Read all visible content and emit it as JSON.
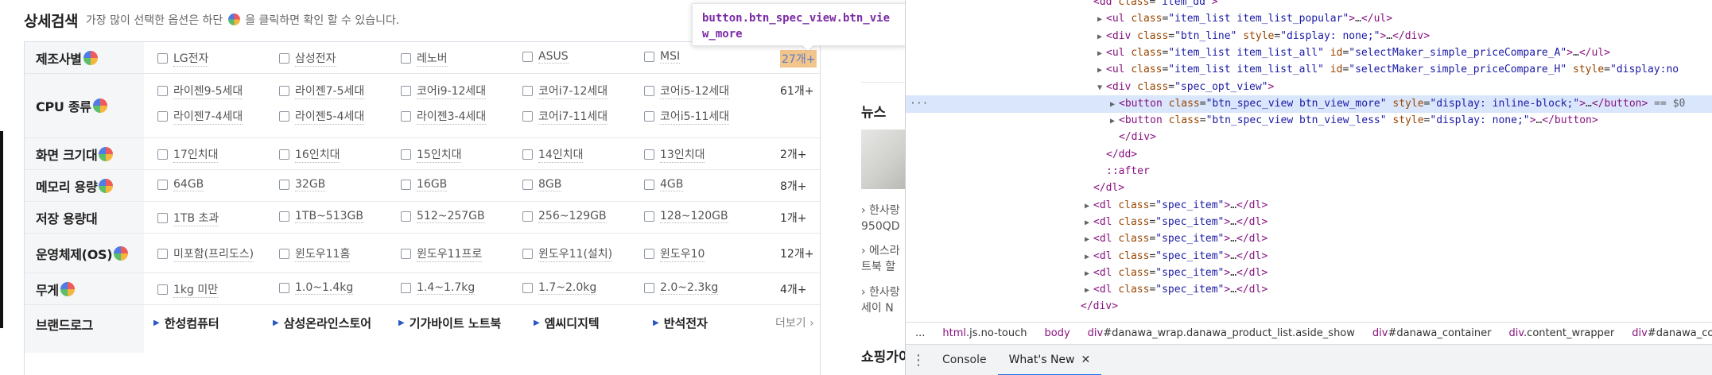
{
  "header": {
    "title": "상세검색",
    "desc_before": "가장 많이 선택한 옵션은 하단",
    "desc_after": "을 클릭하면 확인 할 수 있습니다."
  },
  "tooltip": {
    "text": "button.btn_spec_view.btn_view_more"
  },
  "filters": [
    {
      "label": "제조사별",
      "has_ball": true,
      "options": [
        "LG전자",
        "삼성전자",
        "레노버",
        "ASUS",
        "MSI"
      ],
      "more": "27개+",
      "more_highlighted": true
    },
    {
      "label": "CPU 종류",
      "has_ball": true,
      "options": [
        "라이젠9-5세대",
        "라이젠7-5세대",
        "코어i9-12세대",
        "코어i7-12세대",
        "코어i5-12세대"
      ],
      "options2": [
        "라이젠7-4세대",
        "라이젠5-4세대",
        "라이젠3-4세대",
        "코어i7-11세대",
        "코어i5-11세대"
      ],
      "more": "61개+"
    },
    {
      "label": "화면 크기대",
      "has_ball": true,
      "options": [
        "17인치대",
        "16인치대",
        "15인치대",
        "14인치대",
        "13인치대"
      ],
      "more": "2개+"
    },
    {
      "label": "메모리 용량",
      "has_ball": true,
      "options": [
        "64GB",
        "32GB",
        "16GB",
        "8GB",
        "4GB"
      ],
      "more": "8개+"
    },
    {
      "label": "저장 용량대",
      "has_ball": false,
      "options": [
        "1TB 초과",
        "1TB~513GB",
        "512~257GB",
        "256~129GB",
        "128~120GB"
      ],
      "more": "1개+"
    },
    {
      "label": "운영체제(OS)",
      "has_ball": true,
      "options": [
        "미포함(프리도스)",
        "윈도우11홈",
        "윈도우11프로",
        "윈도우11(설치)",
        "윈도우10"
      ],
      "more": "12개+"
    },
    {
      "label": "무게",
      "has_ball": true,
      "options": [
        "1kg 미만",
        "1.0~1.4kg",
        "1.4~1.7kg",
        "1.7~2.0kg",
        "2.0~2.3kg"
      ],
      "more": "4개+"
    }
  ],
  "brand_row": {
    "label": "브랜드로그",
    "items": [
      "한성컴퓨터",
      "삼성온라인스토어",
      "기가바이트 노트북",
      "엠씨디지텍",
      "반석전자"
    ],
    "more": "더보기"
  },
  "sidebar": {
    "news_title": "뉴스",
    "items": [
      "› 한사랑",
      "950QD",
      "› 에스라",
      "트북 할",
      "› 한사랑",
      "세이 N"
    ],
    "shop_title": "쇼핑가이"
  },
  "devtools": {
    "lines": [
      {
        "indent": 0,
        "tri": "",
        "html": "<span class='tag'>&lt;dd</span> <span class='an'>class</span>=<span class='av'>\"item_dd\"</span><span class='tag'>&gt;</span>"
      },
      {
        "indent": 1,
        "tri": "▶",
        "html": "<span class='tag'>&lt;ul</span> <span class='an'>class</span>=<span class='av'>\"item_list item_list_popular\"</span><span class='tag'>&gt;</span>…<span class='tag'>&lt;/ul&gt;</span>"
      },
      {
        "indent": 1,
        "tri": "▶",
        "html": "<span class='tag'>&lt;div</span> <span class='an'>class</span>=<span class='av'>\"btn_line\"</span> <span class='an'>style</span>=<span class='av'>\"display: none;\"</span><span class='tag'>&gt;</span>…<span class='tag'>&lt;/div&gt;</span>"
      },
      {
        "indent": 1,
        "tri": "▶",
        "html": "<span class='tag'>&lt;ul</span> <span class='an'>class</span>=<span class='av'>\"item_list item_list_all\"</span> <span class='an'>id</span>=<span class='av'>\"selectMaker_simple_priceCompare_A\"</span><span class='tag'>&gt;</span>…<span class='tag'>&lt;/ul&gt;</span>"
      },
      {
        "indent": 1,
        "tri": "▶",
        "html": "<span class='tag'>&lt;ul</span> <span class='an'>class</span>=<span class='av'>\"item_list item_list_all\"</span> <span class='an'>id</span>=<span class='av'>\"selectMaker_simple_priceCompare_H\"</span> <span class='an'>style</span>=<span class='av'>\"display:no</span>"
      },
      {
        "indent": 1,
        "tri": "▼",
        "html": "<span class='tag'>&lt;div</span> <span class='an'>class</span>=<span class='av'>\"spec_opt_view\"</span><span class='tag'>&gt;</span>"
      },
      {
        "indent": 2,
        "tri": "▶",
        "sel": true,
        "html": "<span class='tag'>&lt;button</span> <span class='an'>class</span>=<span class='av'>\"btn_spec_view btn_view_more\"</span> <span class='an'>style</span>=<span class='av'>\"display: inline-block;\"</span><span class='tag'>&gt;</span>…<span class='tag'>&lt;/button&gt;</span> <span class='eq'>== $0</span>"
      },
      {
        "indent": 2,
        "tri": "▶",
        "html": "<span class='tag'>&lt;button</span> <span class='an'>class</span>=<span class='av'>\"btn_spec_view btn_view_less\"</span> <span class='an'>style</span>=<span class='av'>\"display: none;\"</span><span class='tag'>&gt;</span>…<span class='tag'>&lt;/button&gt;</span>"
      },
      {
        "indent": 2,
        "tri": "",
        "html": "<span class='tag'>&lt;/div&gt;</span>"
      },
      {
        "indent": 1,
        "tri": "",
        "html": "<span class='tag'>&lt;/dd&gt;</span>"
      },
      {
        "indent": 1,
        "tri": "",
        "html": "<span class='pseudo'>::after</span>"
      },
      {
        "indent": 0,
        "tri": "",
        "html": "<span class='tag'>&lt;/dl&gt;</span>"
      },
      {
        "indent": 0,
        "tri": "▶",
        "html": "<span class='tag'>&lt;dl</span> <span class='an'>class</span>=<span class='av'>\"spec_item\"</span><span class='tag'>&gt;</span>…<span class='tag'>&lt;/dl&gt;</span>"
      },
      {
        "indent": 0,
        "tri": "▶",
        "html": "<span class='tag'>&lt;dl</span> <span class='an'>class</span>=<span class='av'>\"spec_item\"</span><span class='tag'>&gt;</span>…<span class='tag'>&lt;/dl&gt;</span>"
      },
      {
        "indent": 0,
        "tri": "▶",
        "html": "<span class='tag'>&lt;dl</span> <span class='an'>class</span>=<span class='av'>\"spec_item\"</span><span class='tag'>&gt;</span>…<span class='tag'>&lt;/dl&gt;</span>"
      },
      {
        "indent": 0,
        "tri": "▶",
        "html": "<span class='tag'>&lt;dl</span> <span class='an'>class</span>=<span class='av'>\"spec_item\"</span><span class='tag'>&gt;</span>…<span class='tag'>&lt;/dl&gt;</span>"
      },
      {
        "indent": 0,
        "tri": "▶",
        "html": "<span class='tag'>&lt;dl</span> <span class='an'>class</span>=<span class='av'>\"spec_item\"</span><span class='tag'>&gt;</span>…<span class='tag'>&lt;/dl&gt;</span>"
      },
      {
        "indent": 0,
        "tri": "▶",
        "html": "<span class='tag'>&lt;dl</span> <span class='an'>class</span>=<span class='av'>\"spec_item\"</span><span class='tag'>&gt;</span>…<span class='tag'>&lt;/dl&gt;</span>"
      },
      {
        "indent": -1,
        "tri": "",
        "html": "<span class='tag'>&lt;/div&gt;</span>"
      }
    ],
    "breadcrumbs": [
      "...",
      "html.js.no-touch",
      "body",
      "div#danawa_wrap.danawa_product_list.aside_show",
      "div#danawa_container",
      "div.content_wrapper",
      "div#danawa_conte"
    ],
    "drawer_tabs": [
      {
        "label": "Console",
        "active": false
      },
      {
        "label": "What's New",
        "active": true
      }
    ],
    "close_glyph": "✕"
  }
}
